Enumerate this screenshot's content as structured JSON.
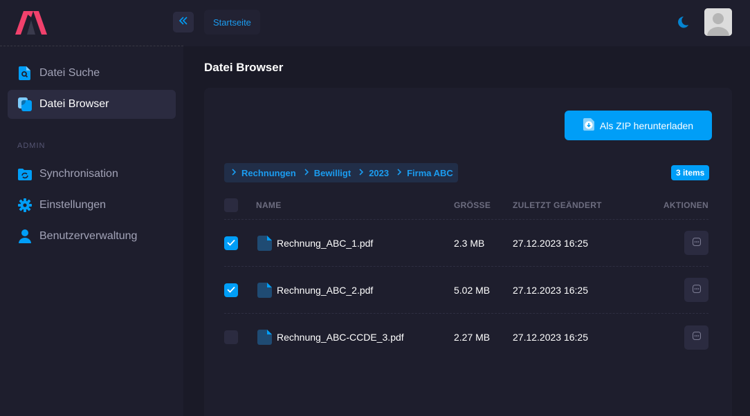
{
  "colors": {
    "accent": "#009ef7",
    "brand_red": "#f1416c",
    "sidebar_bg": "#1e1e2d",
    "page_bg": "#1a1a27"
  },
  "sidebar": {
    "items": [
      {
        "label": "Datei Suche",
        "icon": "file-search-icon",
        "active": false
      },
      {
        "label": "Datei Browser",
        "icon": "file-browser-icon",
        "active": true
      }
    ],
    "section_label": "ADMIN",
    "admin_items": [
      {
        "label": "Synchronisation",
        "icon": "folder-sync-icon"
      },
      {
        "label": "Einstellungen",
        "icon": "gear-icon"
      },
      {
        "label": "Benutzerverwaltung",
        "icon": "user-icon"
      }
    ]
  },
  "topbar": {
    "breadcrumb_home": "Startseite"
  },
  "page": {
    "title": "Datei Browser"
  },
  "toolbar": {
    "zip_label": "Als ZIP herunterladen"
  },
  "path": [
    "Rechnungen",
    "Bewilligt",
    "2023",
    "Firma ABC"
  ],
  "item_count": "3 items",
  "table": {
    "columns": [
      "NAME",
      "GRÖSSE",
      "ZULETZT GEÄNDERT",
      "AKTIONEN"
    ],
    "rows": [
      {
        "name": "Rechnung_ABC_1.pdf",
        "size": "2.3 MB",
        "modified": "27.12.2023 16:25",
        "checked": true
      },
      {
        "name": "Rechnung_ABC_2.pdf",
        "size": "5.02 MB",
        "modified": "27.12.2023 16:25",
        "checked": true
      },
      {
        "name": "Rechnung_ABC-CCDE_3.pdf",
        "size": "2.27 MB",
        "modified": "27.12.2023 16:25",
        "checked": false
      }
    ]
  }
}
